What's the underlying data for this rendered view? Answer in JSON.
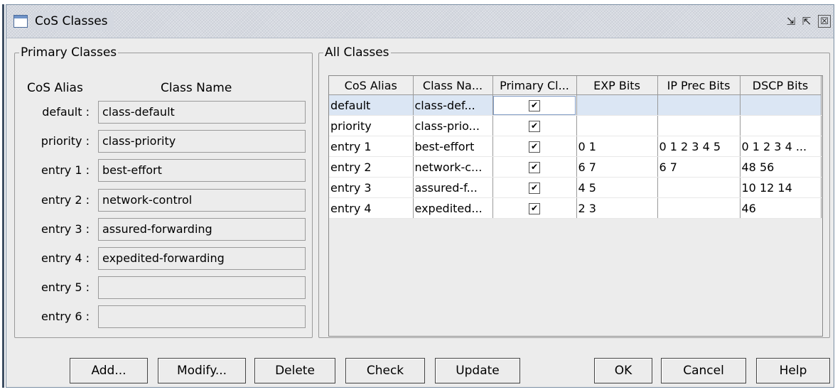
{
  "window": {
    "title": "CoS Classes",
    "icons": {
      "app": "window-icon",
      "minimize": "restore-icon",
      "maximize": "maximize-icon",
      "close": "close-icon"
    },
    "close_glyph": "☒",
    "restore_glyph": "⇲",
    "maximize_glyph": "⇱"
  },
  "primary": {
    "legend": "Primary Classes",
    "col_alias": "CoS Alias",
    "col_name": "Class Name",
    "rows": [
      {
        "label": "default :",
        "value": "class-default"
      },
      {
        "label": "priority :",
        "value": "class-priority"
      },
      {
        "label": "entry 1 :",
        "value": "best-effort"
      },
      {
        "label": "entry 2 :",
        "value": "network-control"
      },
      {
        "label": "entry 3 :",
        "value": "assured-forwarding"
      },
      {
        "label": "entry 4 :",
        "value": "expedited-forwarding"
      },
      {
        "label": "entry 5 :",
        "value": ""
      },
      {
        "label": "entry 6 :",
        "value": ""
      }
    ]
  },
  "all": {
    "legend": "All Classes",
    "headers": [
      "CoS Alias",
      "Class Na...",
      "Primary Cl...",
      "EXP Bits",
      "IP Prec Bits",
      "DSCP Bits"
    ],
    "rows": [
      {
        "alias": "default",
        "name": "class-def...",
        "primary": "✔",
        "exp": "",
        "ipprec": "",
        "dscp": ""
      },
      {
        "alias": "priority",
        "name": "class-prio...",
        "primary": "✔",
        "exp": "",
        "ipprec": "",
        "dscp": ""
      },
      {
        "alias": "entry 1",
        "name": "best-effort",
        "primary": "✔",
        "exp": "0 1",
        "ipprec": "0 1 2 3 4 5",
        "dscp": "0 1 2 3 4 ..."
      },
      {
        "alias": "entry 2",
        "name": "network-c...",
        "primary": "✔",
        "exp": "6 7",
        "ipprec": "6 7",
        "dscp": "48 56"
      },
      {
        "alias": "entry 3",
        "name": "assured-f...",
        "primary": "✔",
        "exp": "4 5",
        "ipprec": "",
        "dscp": "10 12 14"
      },
      {
        "alias": "entry 4",
        "name": "expedited...",
        "primary": "✔",
        "exp": "2 3",
        "ipprec": "",
        "dscp": "46"
      }
    ],
    "selected_row": 0
  },
  "buttons": {
    "add": "Add...",
    "modify": "Modify...",
    "delete": "Delete",
    "check": "Check",
    "update": "Update",
    "ok": "OK",
    "cancel": "Cancel",
    "help": "Help"
  },
  "colors": {
    "selection": "#dbe6f4",
    "panel": "#ececec",
    "border": "#9a9a9a"
  }
}
